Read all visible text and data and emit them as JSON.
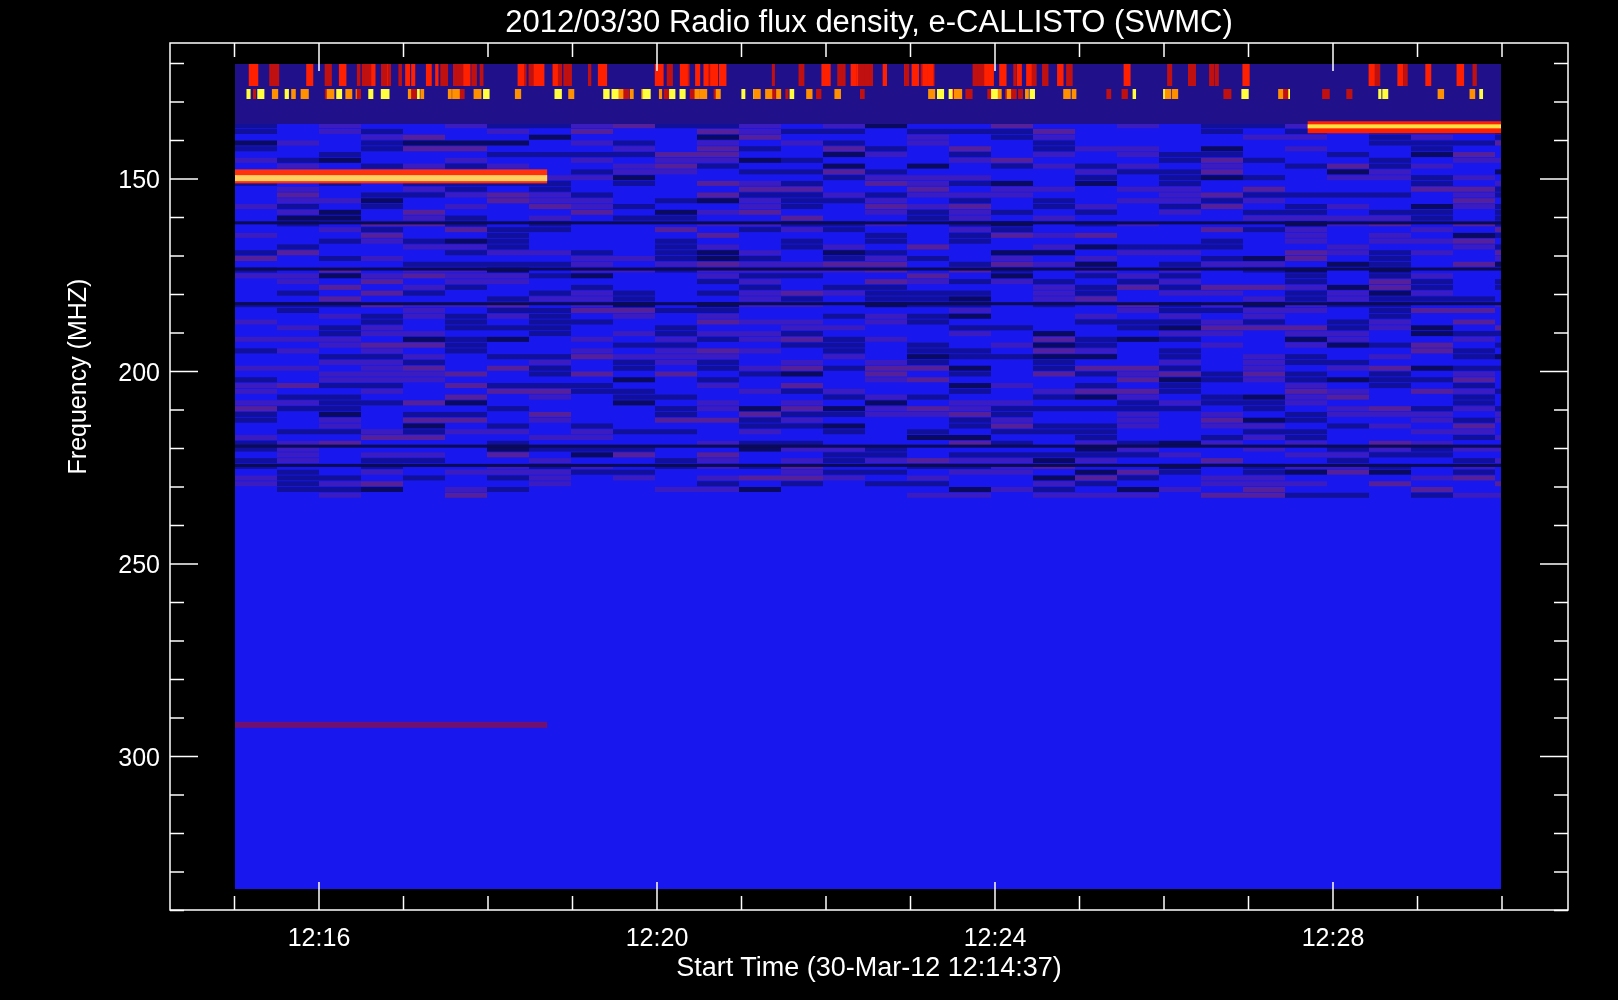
{
  "title": "2012/03/30  Radio flux density, e-CALLISTO (SWMC)",
  "y_axis": {
    "label": "Frequency (MHZ)",
    "ticks": [
      "150",
      "200",
      "250",
      "300"
    ]
  },
  "x_axis": {
    "label": "Start Time (30-Mar-12 12:14:37)",
    "ticks": [
      "12:16",
      "12:20",
      "12:24",
      "12:28"
    ]
  }
}
